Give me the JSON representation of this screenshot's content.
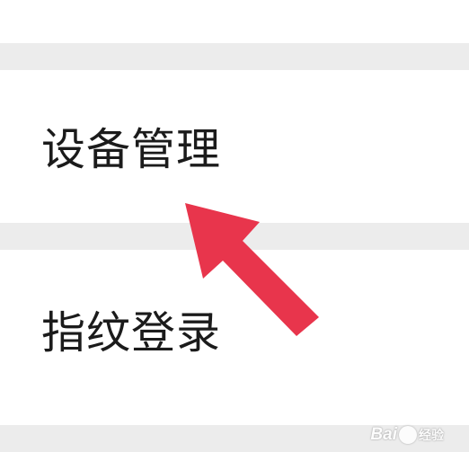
{
  "menu": {
    "items": [
      {
        "label": "设备管理"
      },
      {
        "label": "指纹登录"
      }
    ]
  },
  "annotation": {
    "arrow_color": "#e8354c"
  },
  "watermark": {
    "brand": "Bai",
    "suffix": "经验"
  }
}
